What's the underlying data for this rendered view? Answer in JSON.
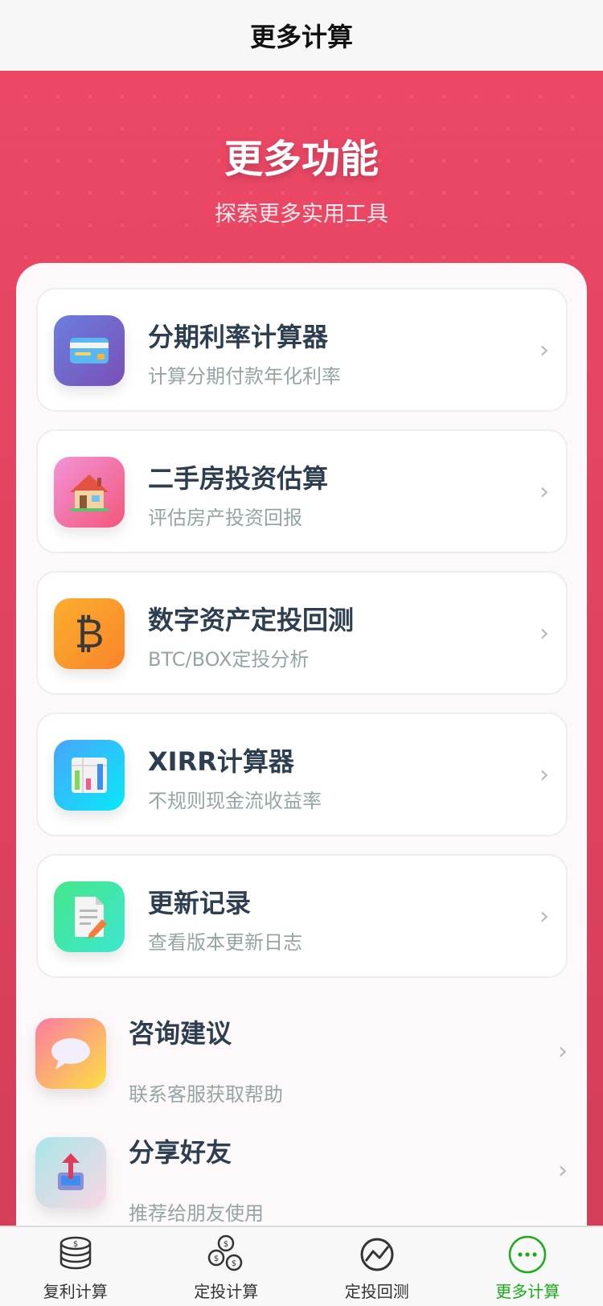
{
  "nav": {
    "title": "更多计算"
  },
  "hero": {
    "title": "更多功能",
    "subtitle": "探索更多实用工具"
  },
  "cards": [
    {
      "title": "分期利率计算器",
      "desc": "计算分期付款年化利率",
      "icon": "credit-card-icon",
      "gradient": [
        "#6b7fe0",
        "#7a4fb5"
      ]
    },
    {
      "title": "二手房投资估算",
      "desc": "评估房产投资回报",
      "icon": "house-icon",
      "gradient": [
        "#f393d8",
        "#f2577a"
      ]
    },
    {
      "title": "数字资产定投回测",
      "desc": "BTC/BOX定投分析",
      "icon": "bitcoin-icon",
      "gradient": [
        "#fbae2e",
        "#f9852b"
      ]
    },
    {
      "title": "XIRR计算器",
      "desc": "不规则现金流收益率",
      "icon": "bar-chart-icon",
      "gradient": [
        "#48a5fb",
        "#08e9f7"
      ]
    },
    {
      "title": "更新记录",
      "desc": "查看版本更新日志",
      "icon": "document-edit-icon",
      "gradient": [
        "#45e78a",
        "#3ce7d0"
      ]
    }
  ],
  "plain_items": [
    {
      "title": "咨询建议",
      "desc": "联系客服获取帮助",
      "icon": "speech-bubble-icon",
      "gradient": [
        "#fb7ba2",
        "#fce043"
      ]
    },
    {
      "title": "分享好友",
      "desc": "推荐给朋友使用",
      "icon": "share-upload-icon",
      "gradient": [
        "#a8e6e8",
        "#fad7e4"
      ]
    }
  ],
  "tabs": [
    {
      "label": "复利计算",
      "icon": "coin-stack-icon",
      "active": false
    },
    {
      "label": "定投计算",
      "icon": "coins-icon",
      "active": false
    },
    {
      "label": "定投回测",
      "icon": "trend-chart-icon",
      "active": false
    },
    {
      "label": "更多计算",
      "icon": "more-icon",
      "active": true
    }
  ],
  "colors": {
    "accent": "#1aad19",
    "hero": "#ec4866",
    "title_text": "#2c3e50",
    "desc_text": "#95a5a6"
  }
}
